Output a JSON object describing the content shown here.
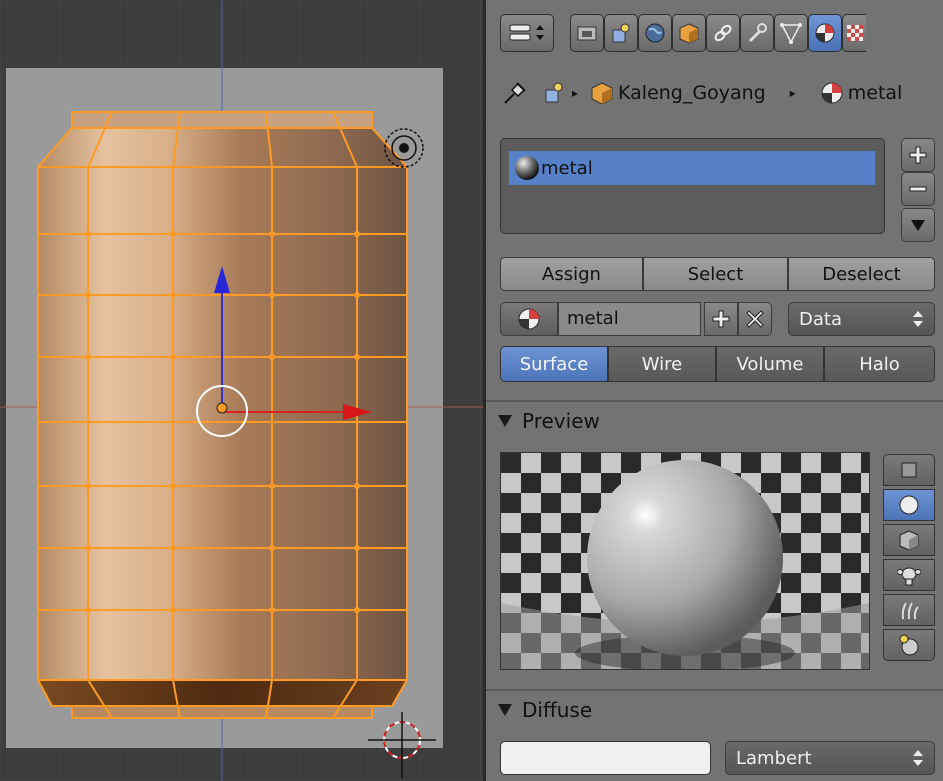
{
  "properties": {
    "breadcrumb": {
      "object_name": "Kaleng_Goyang",
      "material_name": "metal"
    },
    "material_slots": [
      "metal"
    ],
    "slot_buttons": {
      "assign": "Assign",
      "select": "Select",
      "deselect": "Deselect"
    },
    "material_field": {
      "name": "metal",
      "link_mode": "Data"
    },
    "tabs": [
      "Surface",
      "Wire",
      "Volume",
      "Halo"
    ],
    "active_tab": "Surface",
    "sections": {
      "preview": "Preview",
      "diffuse": "Diffuse"
    },
    "diffuse": {
      "shader": "Lambert"
    },
    "colors": {
      "accent": "#5680c8",
      "panel": "#737373",
      "selection": "#ff9f2e"
    },
    "icons": [
      "editor-type-icon",
      "render-icon",
      "render-layers-icon",
      "world-icon",
      "object-icon",
      "constraints-icon",
      "modifier-icon",
      "data-icon",
      "material-icon",
      "texture-icon",
      "pin-icon",
      "scene-icon"
    ]
  }
}
